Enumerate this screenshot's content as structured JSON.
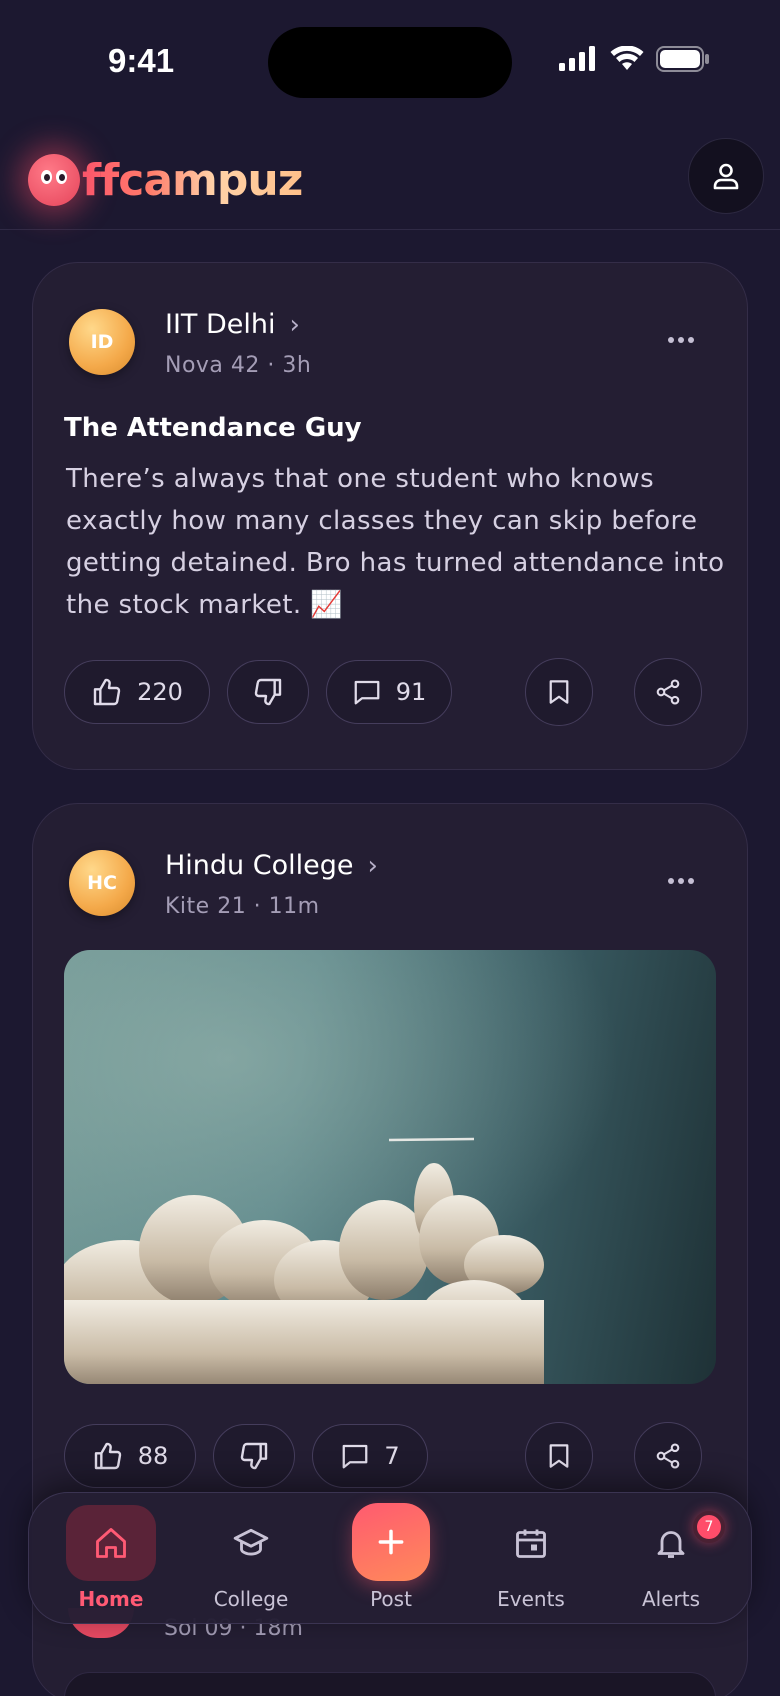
{
  "status_bar": {
    "time": "9:41"
  },
  "header": {
    "logo_text": "ffcampuz"
  },
  "posts": [
    {
      "avatar": "ID",
      "college": "IIT Delhi",
      "meta": "Nova 42 · 3h",
      "title": "The Attendance Guy",
      "body": "There’s always that one student who knows exactly how many classes they can skip before getting detained. Bro has turned attendance into the stock market. 📈",
      "likes": "220",
      "comments": "91"
    },
    {
      "avatar": "HC",
      "college": "Hindu College",
      "meta": "Kite 21 · 11m",
      "likes": "88",
      "comments": "7"
    },
    {
      "meta": "Sol 09 · 18m"
    }
  ],
  "nav": {
    "items": [
      {
        "label": "Home",
        "icon": "home-icon",
        "active": true
      },
      {
        "label": "College",
        "icon": "graduation-cap-icon"
      },
      {
        "label": "Post",
        "icon": "plus-icon"
      },
      {
        "label": "Events",
        "icon": "calendar-icon"
      },
      {
        "label": "Alerts",
        "icon": "bell-icon",
        "badge": "7"
      }
    ]
  },
  "colors": {
    "accent": "#ff5a74",
    "background": "#1c1830",
    "card": "#241e33"
  }
}
